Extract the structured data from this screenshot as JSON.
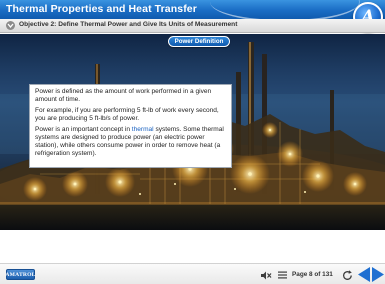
{
  "header": {
    "title": "Thermal Properties and Heat Transfer",
    "logo_letter": "A"
  },
  "objective": {
    "text": "Objective 2: Define Thermal Power and Give Its Units of Measurement"
  },
  "section": {
    "title": "Power Definition"
  },
  "card": {
    "paragraph_1": "Power is defined as the amount of work performed in a given amount of time.",
    "paragraph_2": "For example, if you are performing 5 ft-lb of work every second, you are producing 5 ft-lb/s of power.",
    "paragraph_3_before": "Power is an important concept in ",
    "paragraph_3_keyword": "thermal",
    "paragraph_3_after": " systems. Some thermal systems are designed to produce power (an electric power station), while others consume power in order to remove heat (a refrigeration system)."
  },
  "footer": {
    "brand": "AMATROL",
    "page_indicator": "Page 8 of 131"
  },
  "icons": {
    "objective": "chevron-down-icon",
    "mute": "speaker-mute-icon",
    "menu": "hamburger-menu-icon",
    "replay": "replay-icon",
    "back": "arrow-left-icon",
    "next": "arrow-right-icon"
  },
  "colors": {
    "accent": "#1a6cc4",
    "keyword": "#1a62c0",
    "nav_arrow": "#1f6fd1"
  }
}
